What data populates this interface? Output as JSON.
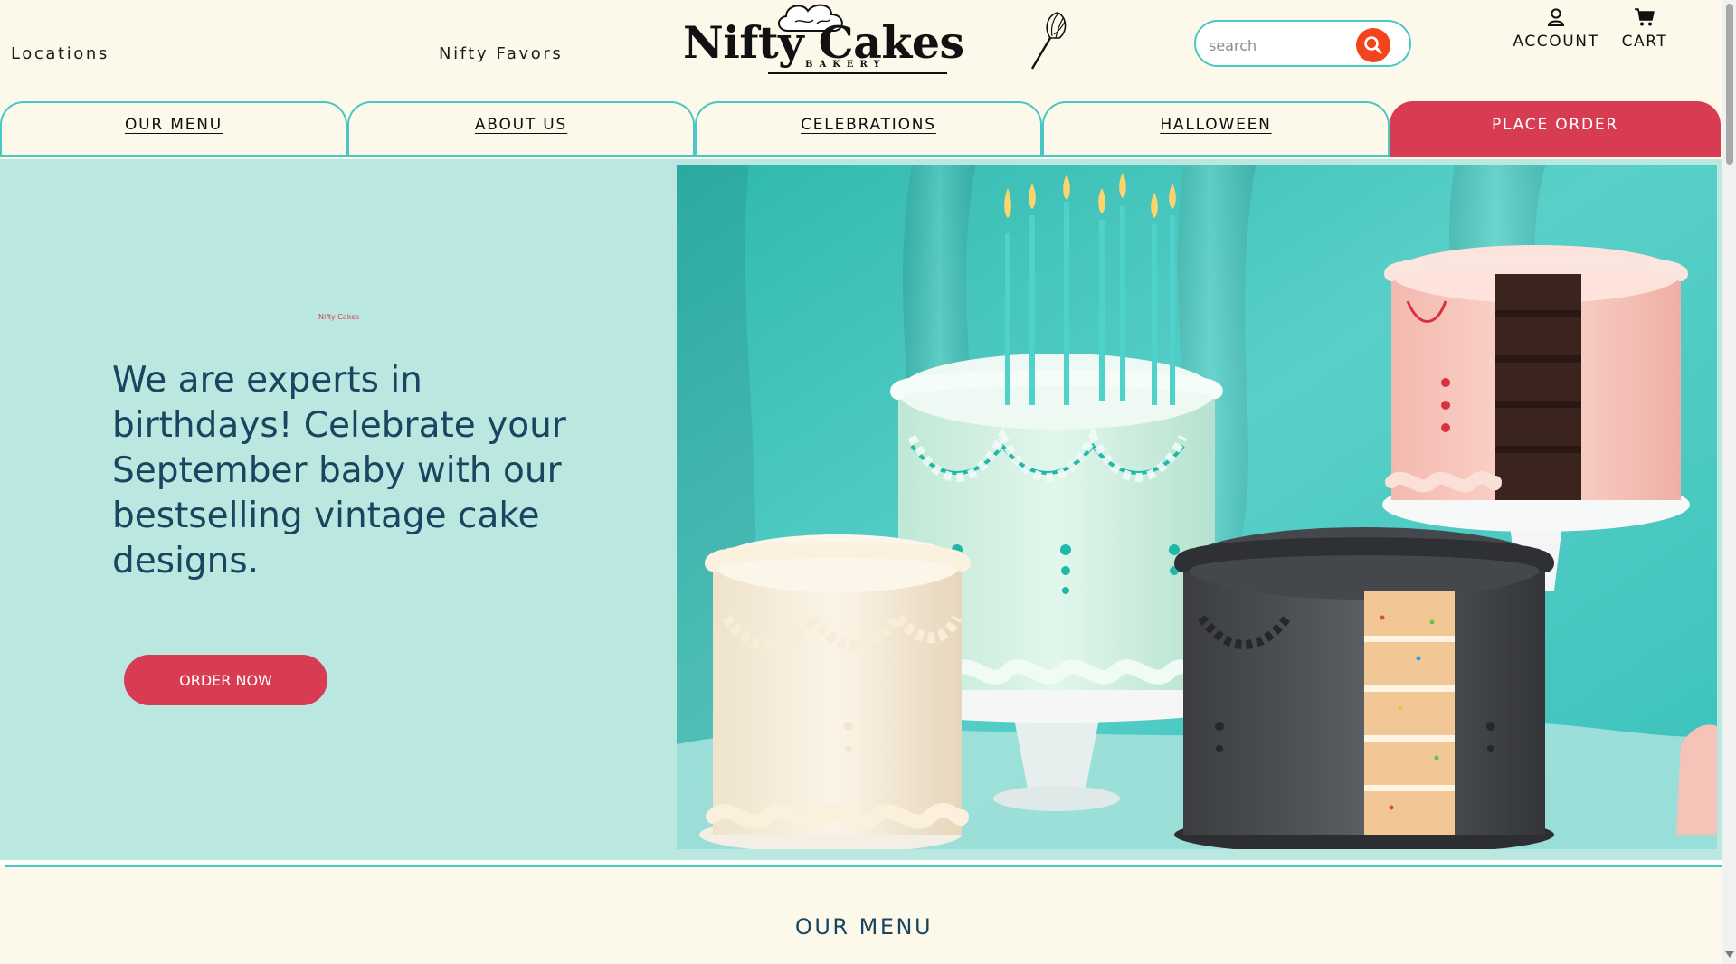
{
  "header": {
    "locations_link": "Locations",
    "favors_link": "Nifty Favors",
    "logo": {
      "wordmark": "Nifty Cakes",
      "subword": "BAKERY"
    },
    "search": {
      "placeholder": "search"
    },
    "account_label": "ACCOUNT",
    "cart_label": "CART"
  },
  "nav": {
    "tabs": [
      {
        "label": "OUR MENU"
      },
      {
        "label": "ABOUT US"
      },
      {
        "label": "CELEBRATIONS"
      },
      {
        "label": "HALLOWEEN"
      },
      {
        "label": "PLACE ORDER"
      }
    ]
  },
  "hero": {
    "kicker": "Nifty Cakes",
    "heading": "We are experts in birthdays! Celebrate your September baby with our bestselling vintage cake designs.",
    "cta_label": "ORDER NOW"
  },
  "menu_section": {
    "title": "OUR MENU"
  },
  "colors": {
    "page_background": "#fdf9ea",
    "hero_background": "#bae7df",
    "accent_teal": "#48c7c4",
    "accent_red": "#d73c52",
    "search_button": "#f2451d",
    "heading_text": "#1a4560"
  },
  "icons": [
    "search-icon",
    "account-icon",
    "cart-icon",
    "chef-hat-icon",
    "whisk-icon"
  ]
}
